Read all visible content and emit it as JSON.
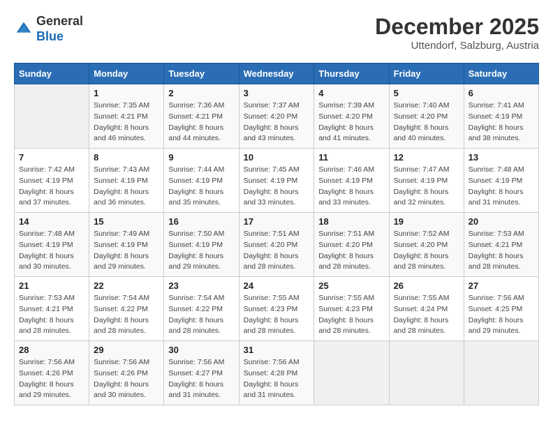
{
  "logo": {
    "general": "General",
    "blue": "Blue"
  },
  "title": "December 2025",
  "subtitle": "Uttendorf, Salzburg, Austria",
  "weekdays": [
    "Sunday",
    "Monday",
    "Tuesday",
    "Wednesday",
    "Thursday",
    "Friday",
    "Saturday"
  ],
  "weeks": [
    [
      {
        "day": "",
        "info": ""
      },
      {
        "day": "1",
        "info": "Sunrise: 7:35 AM\nSunset: 4:21 PM\nDaylight: 8 hours\nand 46 minutes."
      },
      {
        "day": "2",
        "info": "Sunrise: 7:36 AM\nSunset: 4:21 PM\nDaylight: 8 hours\nand 44 minutes."
      },
      {
        "day": "3",
        "info": "Sunrise: 7:37 AM\nSunset: 4:20 PM\nDaylight: 8 hours\nand 43 minutes."
      },
      {
        "day": "4",
        "info": "Sunrise: 7:39 AM\nSunset: 4:20 PM\nDaylight: 8 hours\nand 41 minutes."
      },
      {
        "day": "5",
        "info": "Sunrise: 7:40 AM\nSunset: 4:20 PM\nDaylight: 8 hours\nand 40 minutes."
      },
      {
        "day": "6",
        "info": "Sunrise: 7:41 AM\nSunset: 4:19 PM\nDaylight: 8 hours\nand 38 minutes."
      }
    ],
    [
      {
        "day": "7",
        "info": "Sunrise: 7:42 AM\nSunset: 4:19 PM\nDaylight: 8 hours\nand 37 minutes."
      },
      {
        "day": "8",
        "info": "Sunrise: 7:43 AM\nSunset: 4:19 PM\nDaylight: 8 hours\nand 36 minutes."
      },
      {
        "day": "9",
        "info": "Sunrise: 7:44 AM\nSunset: 4:19 PM\nDaylight: 8 hours\nand 35 minutes."
      },
      {
        "day": "10",
        "info": "Sunrise: 7:45 AM\nSunset: 4:19 PM\nDaylight: 8 hours\nand 33 minutes."
      },
      {
        "day": "11",
        "info": "Sunrise: 7:46 AM\nSunset: 4:19 PM\nDaylight: 8 hours\nand 33 minutes."
      },
      {
        "day": "12",
        "info": "Sunrise: 7:47 AM\nSunset: 4:19 PM\nDaylight: 8 hours\nand 32 minutes."
      },
      {
        "day": "13",
        "info": "Sunrise: 7:48 AM\nSunset: 4:19 PM\nDaylight: 8 hours\nand 31 minutes."
      }
    ],
    [
      {
        "day": "14",
        "info": "Sunrise: 7:48 AM\nSunset: 4:19 PM\nDaylight: 8 hours\nand 30 minutes."
      },
      {
        "day": "15",
        "info": "Sunrise: 7:49 AM\nSunset: 4:19 PM\nDaylight: 8 hours\nand 29 minutes."
      },
      {
        "day": "16",
        "info": "Sunrise: 7:50 AM\nSunset: 4:19 PM\nDaylight: 8 hours\nand 29 minutes."
      },
      {
        "day": "17",
        "info": "Sunrise: 7:51 AM\nSunset: 4:20 PM\nDaylight: 8 hours\nand 28 minutes."
      },
      {
        "day": "18",
        "info": "Sunrise: 7:51 AM\nSunset: 4:20 PM\nDaylight: 8 hours\nand 28 minutes."
      },
      {
        "day": "19",
        "info": "Sunrise: 7:52 AM\nSunset: 4:20 PM\nDaylight: 8 hours\nand 28 minutes."
      },
      {
        "day": "20",
        "info": "Sunrise: 7:53 AM\nSunset: 4:21 PM\nDaylight: 8 hours\nand 28 minutes."
      }
    ],
    [
      {
        "day": "21",
        "info": "Sunrise: 7:53 AM\nSunset: 4:21 PM\nDaylight: 8 hours\nand 28 minutes."
      },
      {
        "day": "22",
        "info": "Sunrise: 7:54 AM\nSunset: 4:22 PM\nDaylight: 8 hours\nand 28 minutes."
      },
      {
        "day": "23",
        "info": "Sunrise: 7:54 AM\nSunset: 4:22 PM\nDaylight: 8 hours\nand 28 minutes."
      },
      {
        "day": "24",
        "info": "Sunrise: 7:55 AM\nSunset: 4:23 PM\nDaylight: 8 hours\nand 28 minutes."
      },
      {
        "day": "25",
        "info": "Sunrise: 7:55 AM\nSunset: 4:23 PM\nDaylight: 8 hours\nand 28 minutes."
      },
      {
        "day": "26",
        "info": "Sunrise: 7:55 AM\nSunset: 4:24 PM\nDaylight: 8 hours\nand 28 minutes."
      },
      {
        "day": "27",
        "info": "Sunrise: 7:56 AM\nSunset: 4:25 PM\nDaylight: 8 hours\nand 29 minutes."
      }
    ],
    [
      {
        "day": "28",
        "info": "Sunrise: 7:56 AM\nSunset: 4:26 PM\nDaylight: 8 hours\nand 29 minutes."
      },
      {
        "day": "29",
        "info": "Sunrise: 7:56 AM\nSunset: 4:26 PM\nDaylight: 8 hours\nand 30 minutes."
      },
      {
        "day": "30",
        "info": "Sunrise: 7:56 AM\nSunset: 4:27 PM\nDaylight: 8 hours\nand 31 minutes."
      },
      {
        "day": "31",
        "info": "Sunrise: 7:56 AM\nSunset: 4:28 PM\nDaylight: 8 hours\nand 31 minutes."
      },
      {
        "day": "",
        "info": ""
      },
      {
        "day": "",
        "info": ""
      },
      {
        "day": "",
        "info": ""
      }
    ]
  ]
}
